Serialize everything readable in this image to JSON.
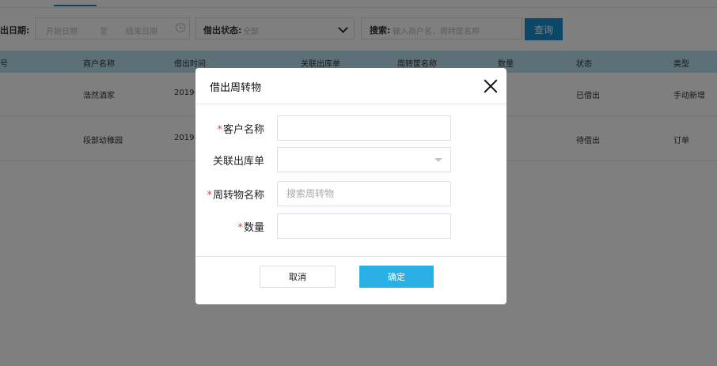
{
  "filters": {
    "date_label": "出日期:",
    "start_placeholder": "开始日期",
    "range_sep": "至",
    "end_placeholder": "结束日期",
    "status_label": "借出状态:",
    "status_value": "全部",
    "search_label": "搜索:",
    "search_placeholder": "输入商户名、周转筐名称",
    "query_button": "查询"
  },
  "table": {
    "headers": [
      "号",
      "商户名称",
      "借出时间",
      "关联出库单",
      "周转筐名称",
      "数量",
      "状态",
      "类型"
    ],
    "rows": [
      {
        "merchant": "浩然酒家",
        "time": "2019-",
        "status": "已借出",
        "type": "手动新增"
      },
      {
        "merchant": "段部幼稚园",
        "time": "2019-",
        "status": "待借出",
        "type": "订单"
      }
    ]
  },
  "modal": {
    "title": "借出周转物",
    "required_mark": "*",
    "fields": {
      "customer": {
        "label": "客户名称",
        "required": true,
        "value": ""
      },
      "outbound": {
        "label": "关联出库单",
        "required": false,
        "value": ""
      },
      "item": {
        "label": "周转物名称",
        "required": true,
        "placeholder": "搜索周转物"
      },
      "quantity": {
        "label": "数量",
        "required": true,
        "value": ""
      }
    },
    "cancel_button": "取消",
    "ok_button": "确定"
  },
  "colors": {
    "accent": "#2ab0e5",
    "query_button": "#1a8fd1",
    "table_header": "#b6e0ee",
    "required": "#e5463b",
    "overlay": "rgba(0,0,0,0.5)"
  },
  "icons": {
    "close": "close-icon",
    "select": "caret-down-icon",
    "date": "clock-icon",
    "status": "chevron-down-icon"
  }
}
